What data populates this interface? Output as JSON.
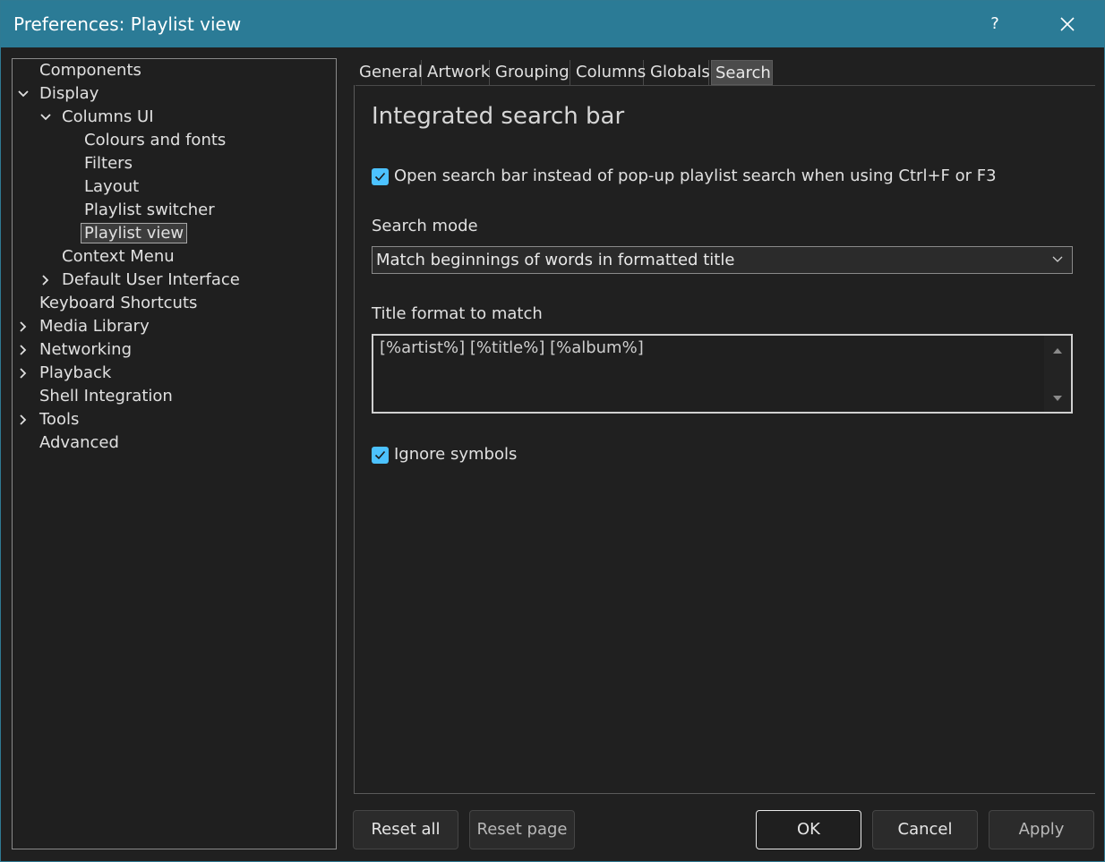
{
  "window": {
    "title": "Preferences: Playlist view",
    "help_label": "?"
  },
  "tree": {
    "items": [
      {
        "label": "Components",
        "level": 0,
        "expander": "none"
      },
      {
        "label": "Display",
        "level": 0,
        "expander": "expanded"
      },
      {
        "label": "Columns UI",
        "level": 1,
        "expander": "expanded"
      },
      {
        "label": "Colours and fonts",
        "level": 2,
        "expander": "none"
      },
      {
        "label": "Filters",
        "level": 2,
        "expander": "none"
      },
      {
        "label": "Layout",
        "level": 2,
        "expander": "none"
      },
      {
        "label": "Playlist switcher",
        "level": 2,
        "expander": "none"
      },
      {
        "label": "Playlist view",
        "level": 2,
        "expander": "none",
        "selected": true
      },
      {
        "label": "Context Menu",
        "level": 1,
        "expander": "none"
      },
      {
        "label": "Default User Interface",
        "level": 1,
        "expander": "collapsed"
      },
      {
        "label": "Keyboard Shortcuts",
        "level": 0,
        "expander": "none"
      },
      {
        "label": "Media Library",
        "level": 0,
        "expander": "collapsed"
      },
      {
        "label": "Networking",
        "level": 0,
        "expander": "collapsed"
      },
      {
        "label": "Playback",
        "level": 0,
        "expander": "collapsed"
      },
      {
        "label": "Shell Integration",
        "level": 0,
        "expander": "none"
      },
      {
        "label": "Tools",
        "level": 0,
        "expander": "collapsed"
      },
      {
        "label": "Advanced",
        "level": 0,
        "expander": "none"
      }
    ]
  },
  "tabs": [
    {
      "label": "General",
      "active": false
    },
    {
      "label": "Artwork",
      "active": false
    },
    {
      "label": "Grouping",
      "active": false
    },
    {
      "label": "Columns",
      "active": false
    },
    {
      "label": "Globals",
      "active": false
    },
    {
      "label": "Search",
      "active": true
    }
  ],
  "search_page": {
    "heading": "Integrated search bar",
    "open_search_bar": {
      "label": "Open search bar instead of pop-up playlist search when using Ctrl+F or F3",
      "checked": true
    },
    "search_mode_label": "Search mode",
    "search_mode_value": "Match beginnings of words in formatted title",
    "title_format_label": "Title format to match",
    "title_format_value": "[%artist%] [%title%] [%album%]",
    "ignore_symbols": {
      "label": "Ignore symbols",
      "checked": true
    }
  },
  "buttons": {
    "reset_all": "Reset all",
    "reset_page": "Reset page",
    "ok": "OK",
    "cancel": "Cancel",
    "apply": "Apply"
  },
  "colors": {
    "titlebar": "#2b7b96",
    "accent_checkbox": "#4cc2ff",
    "background": "#202020"
  }
}
